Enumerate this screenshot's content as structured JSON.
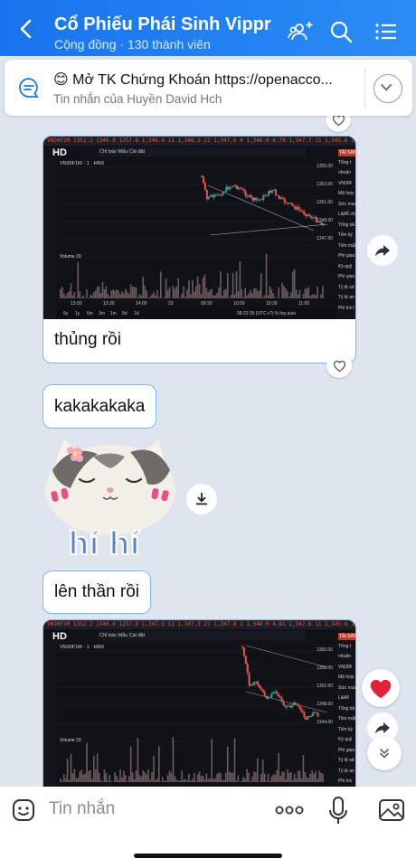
{
  "header": {
    "title": "Cổ Phiếu Phái Sinh Vippr...",
    "subtitle": "Cộng đồng · 130 thành viên",
    "icons": [
      "back-arrow-icon",
      "group-add-icon",
      "search-icon",
      "menu-list-icon"
    ]
  },
  "pinned": {
    "emoji": "😊",
    "text": "Mở TK Chứng Khoán https://openacco...",
    "sub": "Tin nhắn của Huyền David Hch"
  },
  "messages": [
    {
      "type": "image",
      "caption": "thủng rồi",
      "chart": {
        "hd_label": "HD",
        "symbol": "VN30F1M · 1 · HNX",
        "toolbar": "Chỉ báo   Mẫu   Cài đặt",
        "volume_label": "Volume 20",
        "price_ticks": [
          "1355.00",
          "1353.00",
          "1351.00",
          "1349.00",
          "1347.00"
        ],
        "time_ticks": [
          "13:00",
          "13:30",
          "14:00",
          "23",
          "09:30",
          "10:00",
          "10:30",
          "11:00"
        ],
        "side_labels": [
          "TÀI SẢN",
          "Tổng t",
          "nhuận",
          "VN30F",
          "Mã hợp",
          "Sức mua",
          "Lãi/lỗ ch",
          "Tổng tài",
          "Tiền ký",
          "Tiền mặt",
          "Phí giao",
          "Ký quỹ",
          "Phí giao",
          "Tỷ lệ sd",
          "Tỷ lệ an",
          "Phí trả t"
        ],
        "bottom_labels": [
          "5y",
          "1y",
          "6m",
          "3m",
          "1m",
          "5d",
          "1d"
        ],
        "status": "08:22:39 (UTC+7)  %  log  auto"
      }
    },
    {
      "type": "text",
      "text": "kakakakaka"
    },
    {
      "type": "sticker",
      "text": "hí hí"
    },
    {
      "type": "text",
      "text": "lên thần rồi"
    },
    {
      "type": "image",
      "chart": {
        "hd_label": "HD",
        "symbol": "VN30F1M · 1 · HNX",
        "toolbar": "Chỉ báo   Mẫu   Cài đặt",
        "volume_label": "Volume 20",
        "price_ticks": [
          "1360.00",
          "1356.00",
          "1352.00",
          "1348.00",
          "1344.00"
        ],
        "side_labels": [
          "TÀI SẢN",
          "Tổng t",
          "nhuận",
          "VN30F",
          "Mã hợp",
          "Sức mua",
          "Lãi/lỗ",
          "Tổng tài",
          "Tiền mặt",
          "Tiền ký",
          "Ký quỹ",
          "Phí giao",
          "Tỷ lệ sd",
          "Tỷ lệ an",
          "Phí trả"
        ]
      }
    }
  ],
  "input": {
    "placeholder": "Tin nhắn",
    "icons": [
      "sticker-icon",
      "more-dots-icon",
      "microphone-icon",
      "image-icon"
    ]
  },
  "colors": {
    "header": "#1a74ee",
    "bubble_border": "#7fb6f0",
    "chart_bg": "#101218",
    "candle_up": "#26a69a",
    "candle_down": "#ef5350",
    "heart": "#e5213a"
  }
}
